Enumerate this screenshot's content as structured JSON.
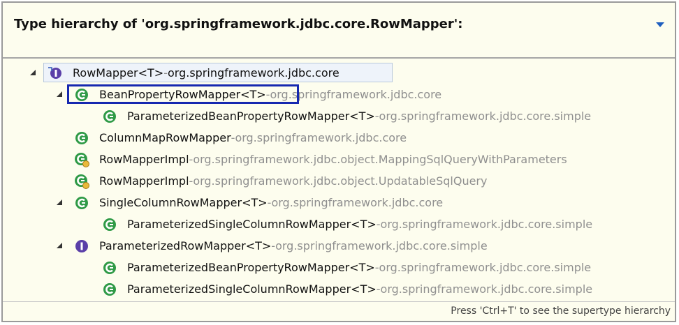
{
  "header": {
    "title": "Type hierarchy of 'org.springframework.jdbc.core.RowMapper':"
  },
  "tree": {
    "rows": [
      {
        "name": "RowMapper<T>",
        "pkg": "org.springframework.jdbc.core",
        "icon": "interface-icon",
        "expanded": true,
        "selected": true
      },
      {
        "name": "BeanPropertyRowMapper<T>",
        "pkg": "org.springframework.jdbc.core",
        "icon": "class-icon",
        "expanded": true,
        "highlighted": true
      },
      {
        "name": "ParameterizedBeanPropertyRowMapper<T>",
        "pkg": "org.springframework.jdbc.core.simple",
        "icon": "class-icon"
      },
      {
        "name": "ColumnMapRowMapper",
        "pkg": "org.springframework.jdbc.core",
        "icon": "class-icon"
      },
      {
        "name": "RowMapperImpl",
        "pkg": "org.springframework.jdbc.object.MappingSqlQueryWithParameters",
        "icon": "inner-class-icon"
      },
      {
        "name": "RowMapperImpl",
        "pkg": "org.springframework.jdbc.object.UpdatableSqlQuery",
        "icon": "inner-class-icon"
      },
      {
        "name": "SingleColumnRowMapper<T>",
        "pkg": "org.springframework.jdbc.core",
        "icon": "class-icon",
        "expanded": true
      },
      {
        "name": "ParameterizedSingleColumnRowMapper<T>",
        "pkg": "org.springframework.jdbc.core.simple",
        "icon": "class-icon"
      },
      {
        "name": "ParameterizedRowMapper<T>",
        "pkg": "org.springframework.jdbc.core.simple",
        "icon": "interface-icon",
        "expanded": true
      },
      {
        "name": "ParameterizedBeanPropertyRowMapper<T>",
        "pkg": "org.springframework.jdbc.core.simple",
        "icon": "class-icon"
      },
      {
        "name": "ParameterizedSingleColumnRowMapper<T>",
        "pkg": "org.springframework.jdbc.core.simple",
        "icon": "class-icon"
      }
    ],
    "separator": " - "
  },
  "footer": {
    "hint": "Press 'Ctrl+T' to see the supertype hierarchy"
  },
  "colors": {
    "background": "#fdfdee",
    "class_icon": "#2f9a46",
    "interface_icon": "#5a3fa8",
    "highlight_border": "#1628b0",
    "package_text": "#8f8f8f"
  }
}
